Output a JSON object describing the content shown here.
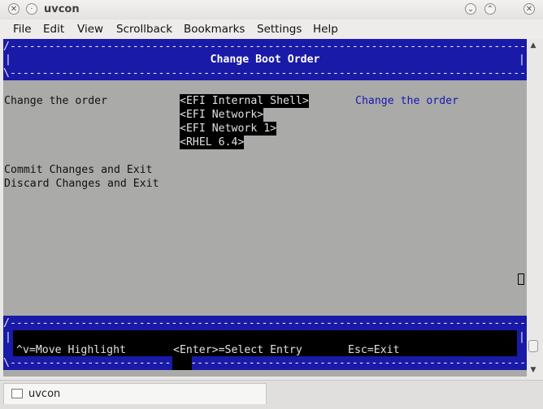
{
  "window": {
    "title": "uvcon",
    "app_icon": "window-menu-icon",
    "controls": [
      "minimize-icon",
      "maximize-icon",
      "close-icon"
    ]
  },
  "menu": {
    "items": [
      "File",
      "Edit",
      "View",
      "Scrollback",
      "Bookmarks",
      "Settings",
      "Help"
    ]
  },
  "terminal": {
    "header_title": "Change Boot Order",
    "option_label": "Change the order",
    "boot_entries": [
      "<EFI Internal Shell>",
      "<EFI Network>",
      "<EFI Network 1>",
      "<RHEL 6.4>"
    ],
    "help_text": "Change the order",
    "commit": "Commit Changes and Exit",
    "discard": "Discard Changes and Exit",
    "footer": {
      "move": "^v=Move Highlight",
      "select": "<Enter>=Select Entry",
      "exit": "Esc=Exit"
    },
    "colors": {
      "band": "#1a1aa8",
      "background": "#aaaaa8",
      "help": "#1818b0"
    }
  },
  "taskbar": {
    "label": "uvcon"
  }
}
